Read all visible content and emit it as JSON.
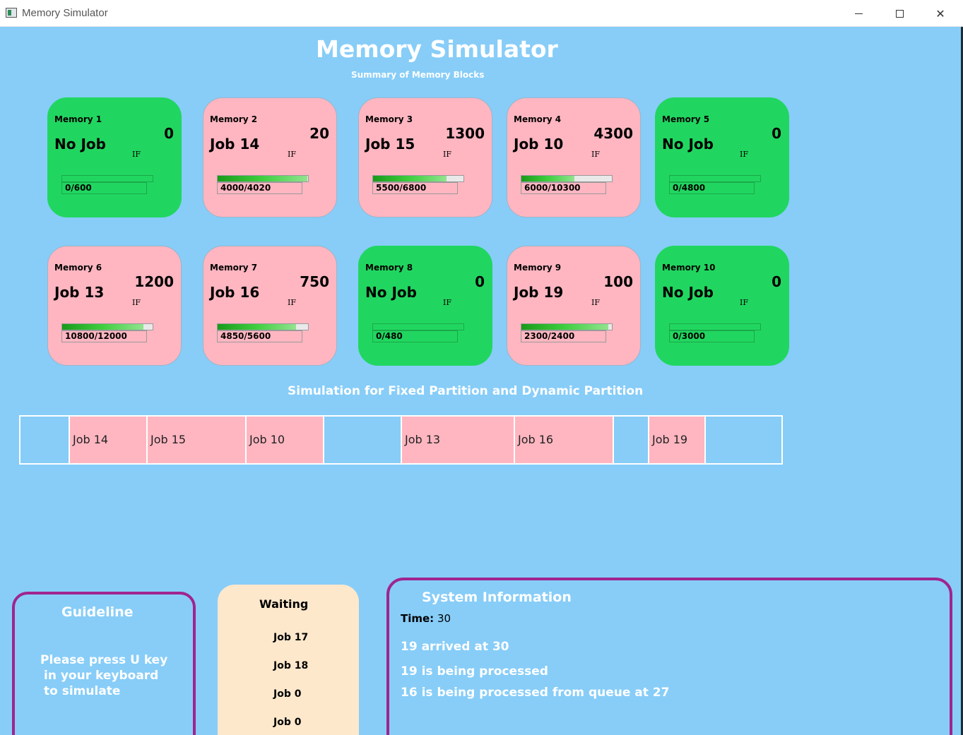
{
  "window": {
    "title": "Memory Simulator",
    "controls": [
      "minimize",
      "maximize",
      "close"
    ]
  },
  "header": {
    "title": "Memory Simulator",
    "subtitle": "Summary of Memory Blocks"
  },
  "memory_blocks": [
    {
      "label": "Memory 1",
      "job": "No Job",
      "fragmentation": "0",
      "tag": "IF",
      "usage": "0/600",
      "fill_fraction": 0.0,
      "state": "free"
    },
    {
      "label": "Memory 2",
      "job": "Job 14",
      "fragmentation": "20",
      "tag": "IF",
      "usage": "4000/4020",
      "fill_fraction": 0.995,
      "state": "busy"
    },
    {
      "label": "Memory 3",
      "job": "Job 15",
      "fragmentation": "1300",
      "tag": "IF",
      "usage": "5500/6800",
      "fill_fraction": 0.809,
      "state": "busy"
    },
    {
      "label": "Memory 4",
      "job": "Job 10",
      "fragmentation": "4300",
      "tag": "IF",
      "usage": "6000/10300",
      "fill_fraction": 0.583,
      "state": "busy"
    },
    {
      "label": "Memory 5",
      "job": "No Job",
      "fragmentation": "0",
      "tag": "IF",
      "usage": "0/4800",
      "fill_fraction": 0.0,
      "state": "free"
    },
    {
      "label": "Memory 6",
      "job": "Job 13",
      "fragmentation": "1200",
      "tag": "IF",
      "usage": "10800/12000",
      "fill_fraction": 0.9,
      "state": "busy"
    },
    {
      "label": "Memory 7",
      "job": "Job 16",
      "fragmentation": "750",
      "tag": "IF",
      "usage": "4850/5600",
      "fill_fraction": 0.866,
      "state": "busy"
    },
    {
      "label": "Memory 8",
      "job": "No Job",
      "fragmentation": "0",
      "tag": "IF",
      "usage": "0/480",
      "fill_fraction": 0.0,
      "state": "free"
    },
    {
      "label": "Memory 9",
      "job": "Job 19",
      "fragmentation": "100",
      "tag": "IF",
      "usage": "2300/2400",
      "fill_fraction": 0.958,
      "state": "busy"
    },
    {
      "label": "Memory 10",
      "job": "No Job",
      "fragmentation": "0",
      "tag": "IF",
      "usage": "0/3000",
      "fill_fraction": 0.0,
      "state": "free"
    }
  ],
  "simulation": {
    "title": "Simulation for Fixed Partition and Dynamic Partition",
    "segments": [
      {
        "label": "",
        "state": "free"
      },
      {
        "label": "Job 14",
        "state": "busy"
      },
      {
        "label": "Job 15",
        "state": "busy"
      },
      {
        "label": "Job 10",
        "state": "busy"
      },
      {
        "label": "",
        "state": "free"
      },
      {
        "label": "Job 13",
        "state": "busy"
      },
      {
        "label": "Job 16",
        "state": "busy"
      },
      {
        "label": "",
        "state": "free"
      },
      {
        "label": "Job 19",
        "state": "busy"
      },
      {
        "label": "",
        "state": "free"
      }
    ]
  },
  "guideline": {
    "title": "Guideline",
    "lines": [
      "Please press U key",
      "in your keyboard",
      "to simulate"
    ]
  },
  "waiting": {
    "title": "Waiting",
    "items": [
      "Job 17",
      "Job 18",
      "Job 0",
      "Job 0"
    ]
  },
  "system_info": {
    "title": "System Information",
    "time_label": "Time:",
    "time_value": "30",
    "log": [
      "19 arrived at 30",
      "19 is being processed",
      "16 is being processed from queue at 27"
    ]
  },
  "colors": {
    "background": "#87cdf8",
    "free_block": "#21d660",
    "busy_block": "#ffb6c1",
    "panel_border": "#a0248f",
    "waiting_panel": "#fde8cc"
  }
}
